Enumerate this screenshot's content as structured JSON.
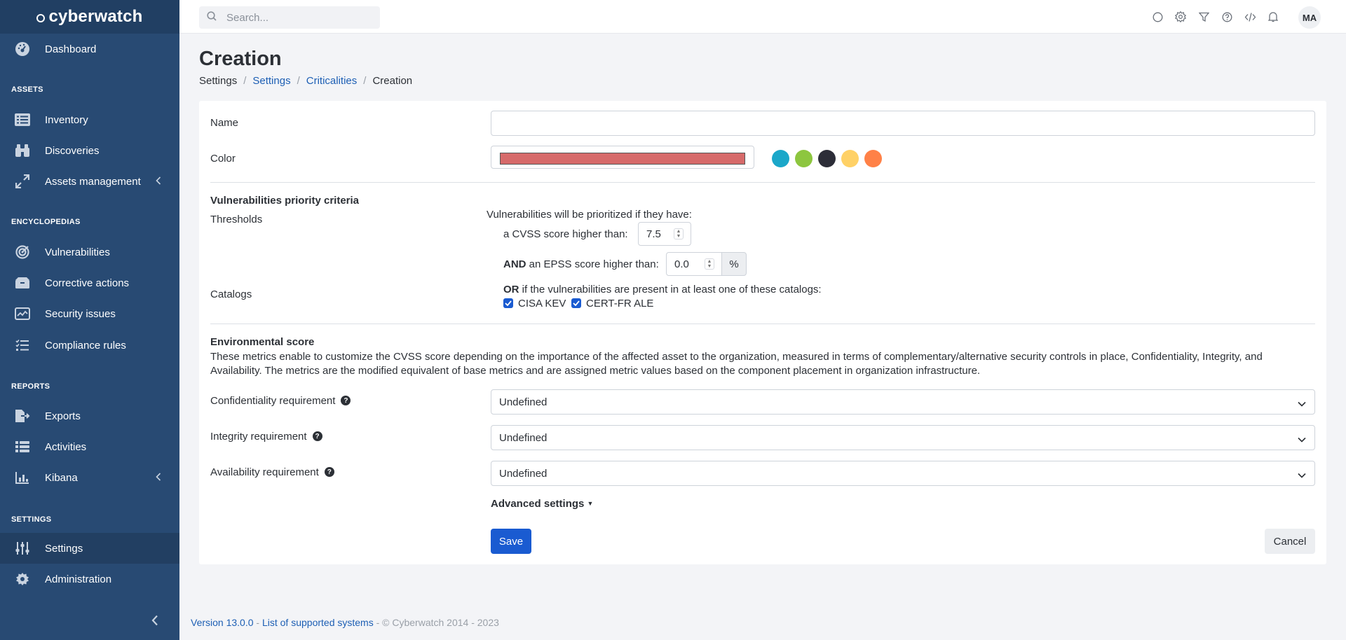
{
  "brand": {
    "name": "cyberwatch"
  },
  "search": {
    "placeholder": "Search..."
  },
  "user": {
    "initials": "MA"
  },
  "topbar_icons": [
    "circle-icon",
    "gear-icon",
    "filter-icon",
    "help-icon",
    "code-icon",
    "bell-icon"
  ],
  "sidebar": {
    "dashboard": "Dashboard",
    "section_assets": "ASSETS",
    "inventory": "Inventory",
    "discoveries": "Discoveries",
    "assets_management": "Assets management",
    "section_encyclopedias": "ENCYCLOPEDIAS",
    "vulnerabilities": "Vulnerabilities",
    "corrective_actions": "Corrective actions",
    "security_issues": "Security issues",
    "compliance_rules": "Compliance rules",
    "section_reports": "REPORTS",
    "exports": "Exports",
    "activities": "Activities",
    "kibana": "Kibana",
    "section_settings": "SETTINGS",
    "settings": "Settings",
    "administration": "Administration"
  },
  "page": {
    "title": "Creation",
    "breadcrumb": {
      "root": "Settings",
      "settings": "Settings",
      "criticalities": "Criticalities",
      "current": "Creation"
    }
  },
  "form": {
    "name_label": "Name",
    "name_value": "",
    "color_label": "Color",
    "color_value": "#d66a6a",
    "swatches": [
      "#1ba7c9",
      "#8dc63f",
      "#2c2d38",
      "#ffd166",
      "#ff8147"
    ],
    "priority": {
      "heading": "Vulnerabilities priority criteria",
      "thresholds_label": "Thresholds",
      "intro": "Vulnerabilities will be prioritized if they have:",
      "cvss_label": "a CVSS score higher than:",
      "cvss_value": "7.5",
      "and_word": "AND",
      "epss_label": "an EPSS score higher than:",
      "epss_value": "0.0",
      "epss_unit": "%",
      "catalogs_label": "Catalogs",
      "or_word": "OR",
      "catalogs_intro": "if the vulnerabilities are present in at least one of these catalogs:",
      "catalog_1": "CISA KEV",
      "catalog_1_checked": true,
      "catalog_2": "CERT-FR ALE",
      "catalog_2_checked": true
    },
    "environmental": {
      "heading": "Environmental score",
      "description": "These metrics enable to customize the CVSS score depending on the importance of the affected asset to the organization, measured in terms of complementary/alternative security controls in place, Confidentiality, Integrity, and Availability. The metrics are the modified equivalent of base metrics and are assigned metric values based on the component placement in organization infrastructure.",
      "confidentiality_label": "Confidentiality requirement",
      "confidentiality_value": "Undefined",
      "integrity_label": "Integrity requirement",
      "integrity_value": "Undefined",
      "availability_label": "Availability requirement",
      "availability_value": "Undefined"
    },
    "advanced_settings": "Advanced settings",
    "save": "Save",
    "cancel": "Cancel"
  },
  "footer": {
    "version": "Version 13.0.0",
    "dash": " - ",
    "supported": "List of supported systems",
    "copyright": " - © Cyberwatch 2014 - 2023"
  },
  "colors": {
    "sidebar": "#284a73",
    "primary": "#1a5bd1",
    "link": "#1d5fb4"
  }
}
